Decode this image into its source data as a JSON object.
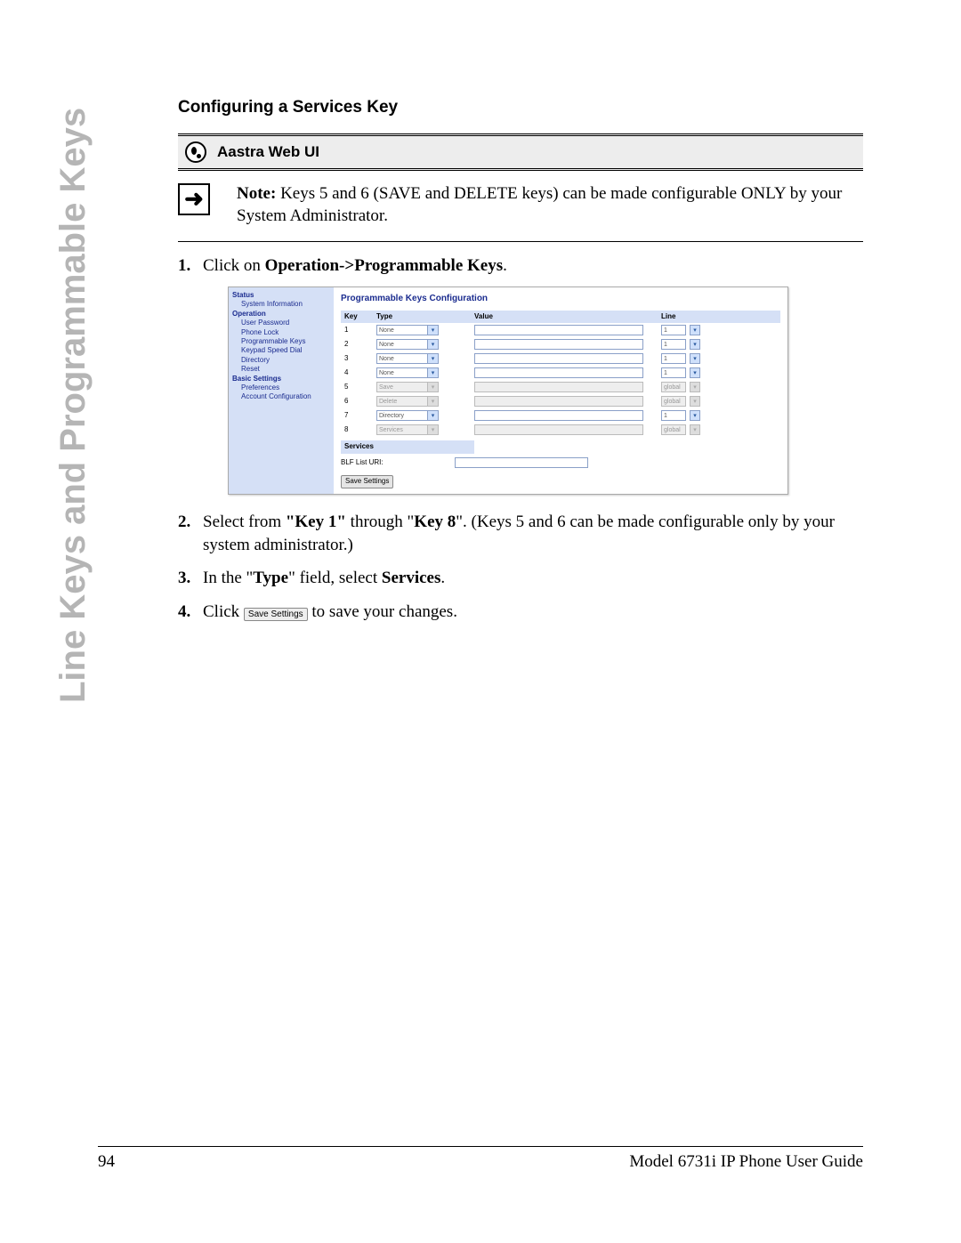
{
  "sidebar": {
    "label": "Line Keys and Programmable Keys"
  },
  "title": "Configuring a Services Key",
  "webui_label": "Aastra Web UI",
  "note": {
    "prefix": "Note:",
    "text": " Keys 5 and 6 (SAVE and DELETE keys) can be made configurable ONLY by your System Administrator."
  },
  "steps": {
    "s1_a": "Click on ",
    "s1_b": "Operation->Programmable Keys",
    "s1_c": ".",
    "s2_a": "Select from ",
    "s2_b": "\"Key 1\"",
    "s2_c": " through \"",
    "s2_d": "Key 8",
    "s2_e": "\". (Keys 5 and 6 can be made configurable only by your system administrator.)",
    "s3_a": "In the \"",
    "s3_b": "Type",
    "s3_c": "\" field, select ",
    "s3_d": "Services",
    "s3_e": ".",
    "s4_a": "Click ",
    "s4_btn": "Save Settings",
    "s4_b": " to save your changes."
  },
  "screenshot": {
    "nav": {
      "status": "Status",
      "sysinfo": "System Information",
      "operation": "Operation",
      "userpw": "User Password",
      "phonelock": "Phone Lock",
      "pkeys": "Programmable Keys",
      "keypad": "Keypad Speed Dial",
      "directory": "Directory",
      "reset": "Reset",
      "basic": "Basic Settings",
      "prefs": "Preferences",
      "acct": "Account Configuration"
    },
    "main_title": "Programmable Keys Configuration",
    "headers": {
      "key": "Key",
      "type": "Type",
      "value": "Value",
      "line": "Line"
    },
    "rows": [
      {
        "key": "1",
        "type": "None",
        "line": "1",
        "disabled": false
      },
      {
        "key": "2",
        "type": "None",
        "line": "1",
        "disabled": false
      },
      {
        "key": "3",
        "type": "None",
        "line": "1",
        "disabled": false
      },
      {
        "key": "4",
        "type": "None",
        "line": "1",
        "disabled": false
      },
      {
        "key": "5",
        "type": "Save",
        "line": "global",
        "disabled": true
      },
      {
        "key": "6",
        "type": "Delete",
        "line": "global",
        "disabled": true
      },
      {
        "key": "7",
        "type": "Directory",
        "line": "1",
        "disabled": false
      },
      {
        "key": "8",
        "type": "Services",
        "line": "global",
        "disabled": true
      }
    ],
    "services_hdr": "Services",
    "blf_label": "BLF List URI:",
    "save_btn": "Save Settings"
  },
  "footer": {
    "page": "94",
    "title": "Model 6731i IP Phone User Guide"
  }
}
